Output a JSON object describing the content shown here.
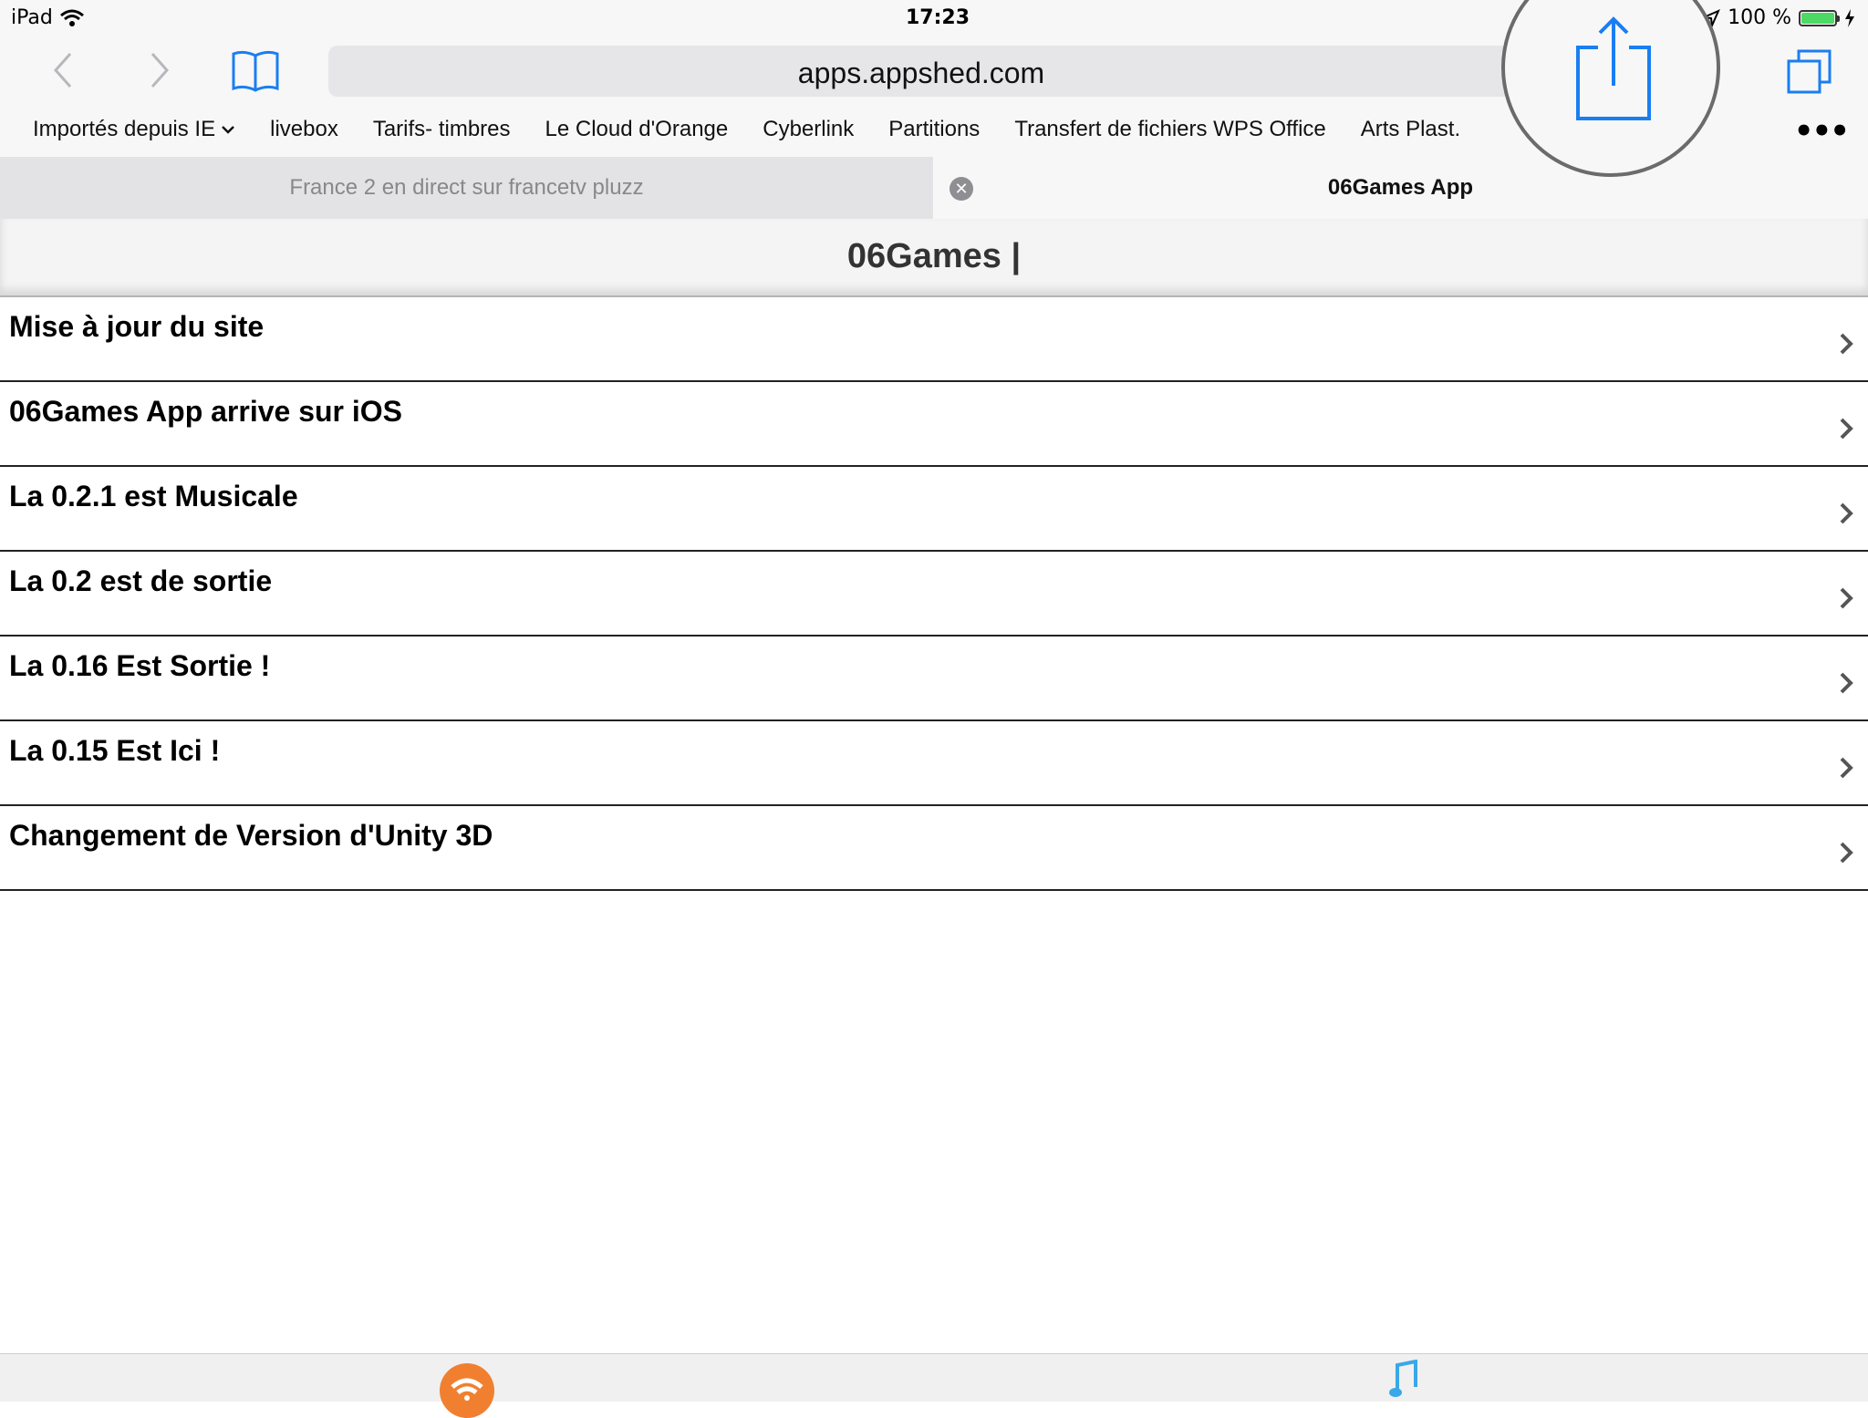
{
  "status_bar": {
    "device": "iPad",
    "time": "17:23",
    "battery": "100 %",
    "battery_level": 1.0
  },
  "toolbar": {
    "url": "apps.appshed.com"
  },
  "bookmarks": [
    "Importés depuis IE",
    "livebox",
    "Tarifs- timbres",
    "Le Cloud d'Orange",
    "Cyberlink",
    "Partitions",
    "Transfert de fichiers WPS Office",
    "Arts Plast."
  ],
  "tabs": [
    {
      "label": "France 2 en direct sur francetv pluzz",
      "active": false
    },
    {
      "label": "06Games App",
      "active": true
    }
  ],
  "page": {
    "title": "06Games |",
    "items": [
      "Mise à jour du site",
      "06Games App arrive sur iOS",
      "La 0.2.1 est Musicale",
      "La 0.2 est de sortie",
      "La 0.16 Est Sortie !",
      "La 0.15 Est Ici !",
      "Changement de Version d'Unity 3D"
    ]
  },
  "colors": {
    "ios_blue": "#1a7ef2",
    "bar_bg": "#f7f7f7",
    "battery_green": "#4cd964",
    "wifi_orange": "#f08030"
  },
  "icons": [
    "wifi-icon",
    "location-icon",
    "battery-icon",
    "charging-icon",
    "back-icon",
    "forward-icon",
    "bookmarks-icon",
    "share-icon",
    "tabs-icon",
    "more-icon",
    "close-icon",
    "chevron-right-icon",
    "music-icon"
  ]
}
